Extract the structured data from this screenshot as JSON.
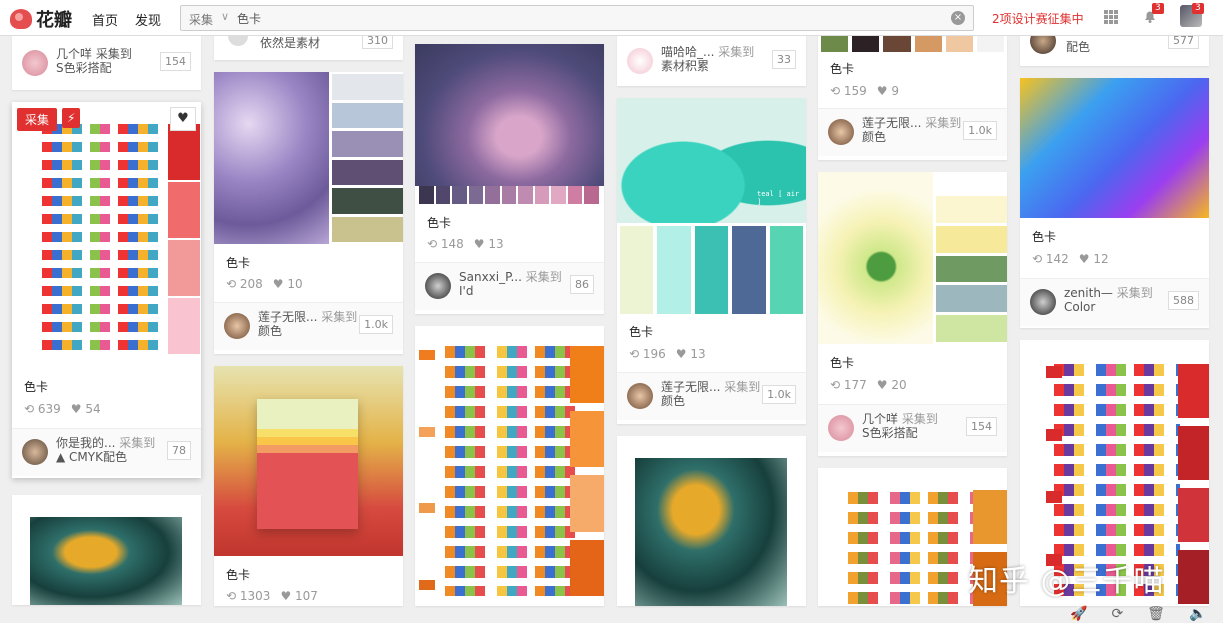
{
  "topbar": {
    "logo_text": "花瓣",
    "nav": [
      "首页",
      "发现"
    ],
    "search": {
      "scope": "采集",
      "value": "色卡"
    },
    "promo": "2项设计赛征集中",
    "notif_badge": "3",
    "avatar_badge": "3"
  },
  "colors": {
    "accent": "#e0302f"
  },
  "cards": {
    "c1a": {
      "who": "几个咩 采集到",
      "board": "S色彩搭配",
      "count": "154"
    },
    "c1b": {
      "title": "色卡",
      "repins": "639",
      "likes": "54",
      "who": "你是我的...",
      "action": "采集到",
      "board": "▲ CMYK配色",
      "count": "78",
      "collect_btn": "采集"
    },
    "c2a": {
      "who": "依然是素材",
      "count": "310"
    },
    "c2b": {
      "title": "色卡",
      "repins": "208",
      "likes": "10",
      "who": "莲子无限...",
      "action": "采集到",
      "board": "颜色",
      "count": "1.0k"
    },
    "c2c": {
      "title": "色卡",
      "repins": "1303",
      "likes": "107"
    },
    "c3a": {
      "title": "色卡",
      "repins": "148",
      "likes": "13",
      "who": "Sanxxi_P...",
      "action": "采集到",
      "board": "I'd",
      "count": "86"
    },
    "c4a": {
      "who": "喵哈哈_...",
      "action": "采集到",
      "board": "素材积累",
      "count": "33"
    },
    "c4b": {
      "title": "色卡",
      "repins": "196",
      "likes": "13",
      "who": "莲子无限...",
      "action": "采集到",
      "board": "颜色",
      "count": "1.0k",
      "img_text": "teal [ air ]"
    },
    "c5a": {
      "title": "色卡",
      "repins": "159",
      "likes": "9",
      "who": "莲子无限...",
      "action": "采集到",
      "board": "颜色",
      "count": "1.0k"
    },
    "c5b": {
      "title": "色卡",
      "repins": "177",
      "likes": "20",
      "who": "几个咩",
      "action": "采集到",
      "board": "S色彩搭配",
      "count": "154"
    },
    "c6a": {
      "board": "配色",
      "count": "577"
    },
    "c6b": {
      "title": "色卡",
      "repins": "142",
      "likes": "12",
      "who": "zenith—",
      "action": "采集到",
      "board": "Color",
      "count": "588"
    }
  },
  "watermark": "知乎 @三千喵",
  "tool_icons": [
    "rocket-icon",
    "refresh-icon",
    "trash-icon",
    "volume-icon"
  ]
}
